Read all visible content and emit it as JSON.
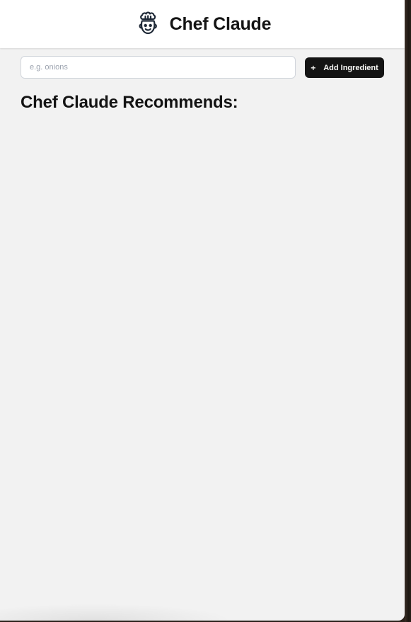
{
  "header": {
    "title": "Chef Claude",
    "logo_icon": "chef-hat-face-icon"
  },
  "form": {
    "input_placeholder": "e.g. onions",
    "input_value": "",
    "add_button_label": "Add Ingredient",
    "add_button_icon": "+"
  },
  "recommendations": {
    "heading": "Chef Claude Recommends:"
  },
  "colors": {
    "background": "#f2f2f2",
    "header_bg": "#ffffff",
    "button_bg": "#141414",
    "button_text": "#fafaf8",
    "text": "#141414"
  }
}
